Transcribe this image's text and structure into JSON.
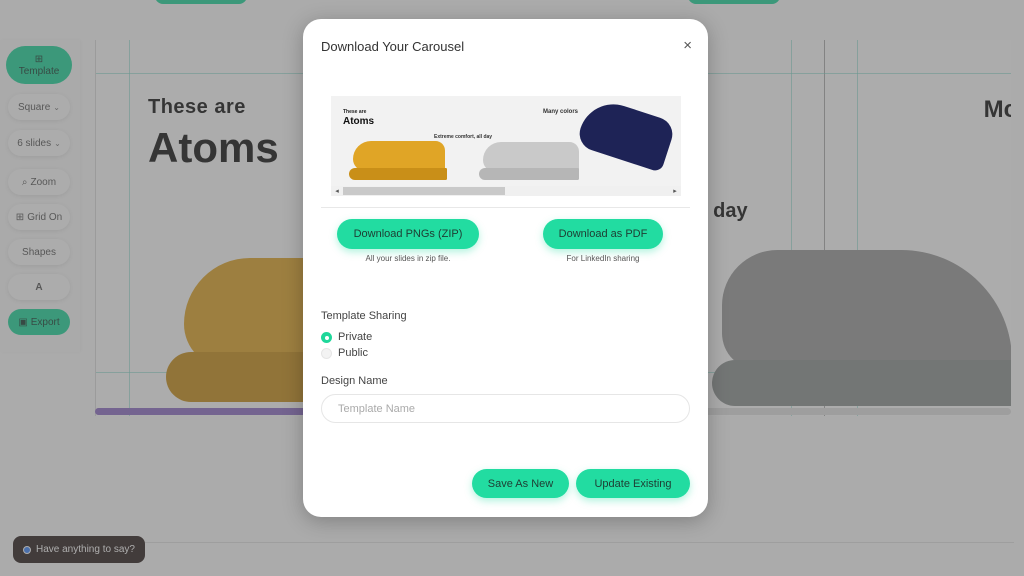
{
  "toolbar": {
    "template_label": "Template",
    "format_label": "Square",
    "slides_label": "6 slides",
    "zoom_label": "Zoom",
    "grid_label": "Grid On",
    "shapes_label": "Shapes",
    "text_label": "A",
    "export_label": "Export"
  },
  "canvas": {
    "small_heading": "These are",
    "big_heading": "Atoms",
    "right_top_text": "Mc",
    "right_mid_text": "l day",
    "colors": {
      "yellow_shoe": "#e0a526",
      "grey_shoe": "#9a9a9a",
      "accent": "#1fd79a"
    }
  },
  "feedback": {
    "label": "Have anything to say?"
  },
  "modal": {
    "title": "Download Your Carousel",
    "close_icon": "×",
    "preview": {
      "small_heading": "These are",
      "big_heading": "Atoms",
      "tagline": "Extreme comfort, all day",
      "colors_label": "Many colors",
      "arrow_left": "◂",
      "arrow_right": "▸"
    },
    "download_png_label": "Download PNGs (ZIP)",
    "download_png_caption": "All your slides in zip file.",
    "download_pdf_label": "Download as PDF",
    "download_pdf_caption": "For LinkedIn sharing",
    "sharing": {
      "label": "Template Sharing",
      "options": [
        "Private",
        "Public"
      ],
      "selected": "Private"
    },
    "design_name": {
      "label": "Design Name",
      "placeholder": "Template Name",
      "value": ""
    },
    "save_new_label": "Save As New",
    "update_label": "Update Existing"
  }
}
